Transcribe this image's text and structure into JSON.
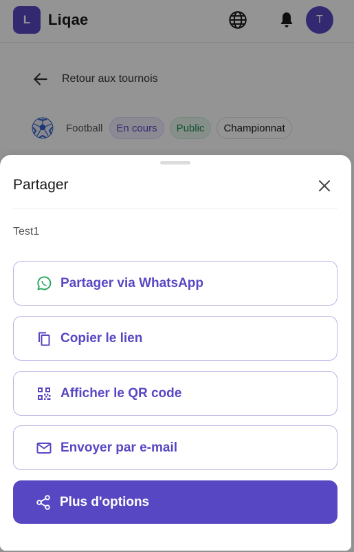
{
  "app": {
    "logo_letter": "L",
    "name": "Liqae",
    "avatar_letter": "T"
  },
  "nav": {
    "back_label": "Retour aux tournois"
  },
  "tournament": {
    "sport": "Football",
    "status": "En cours",
    "visibility": "Public",
    "format": "Championnat"
  },
  "share_sheet": {
    "title": "Partager",
    "item_name": "Test1",
    "options": {
      "whatsapp": "Partager via WhatsApp",
      "copy_link": "Copier le lien",
      "qr_code": "Afficher le QR code",
      "email": "Envoyer par e-mail"
    },
    "more_label": "Plus d'options"
  },
  "icons": {
    "globe": "globe-icon",
    "bell": "bell-icon",
    "back": "arrow-left-icon",
    "close": "close-icon",
    "whatsapp": "whatsapp-icon",
    "copy": "copy-icon",
    "qr": "qr-code-icon",
    "mail": "mail-icon",
    "share": "share-icon"
  },
  "colors": {
    "accent": "#5747c3",
    "whatsapp_green": "#25a65a",
    "overlay": "rgba(0,0,0,0.42)"
  }
}
